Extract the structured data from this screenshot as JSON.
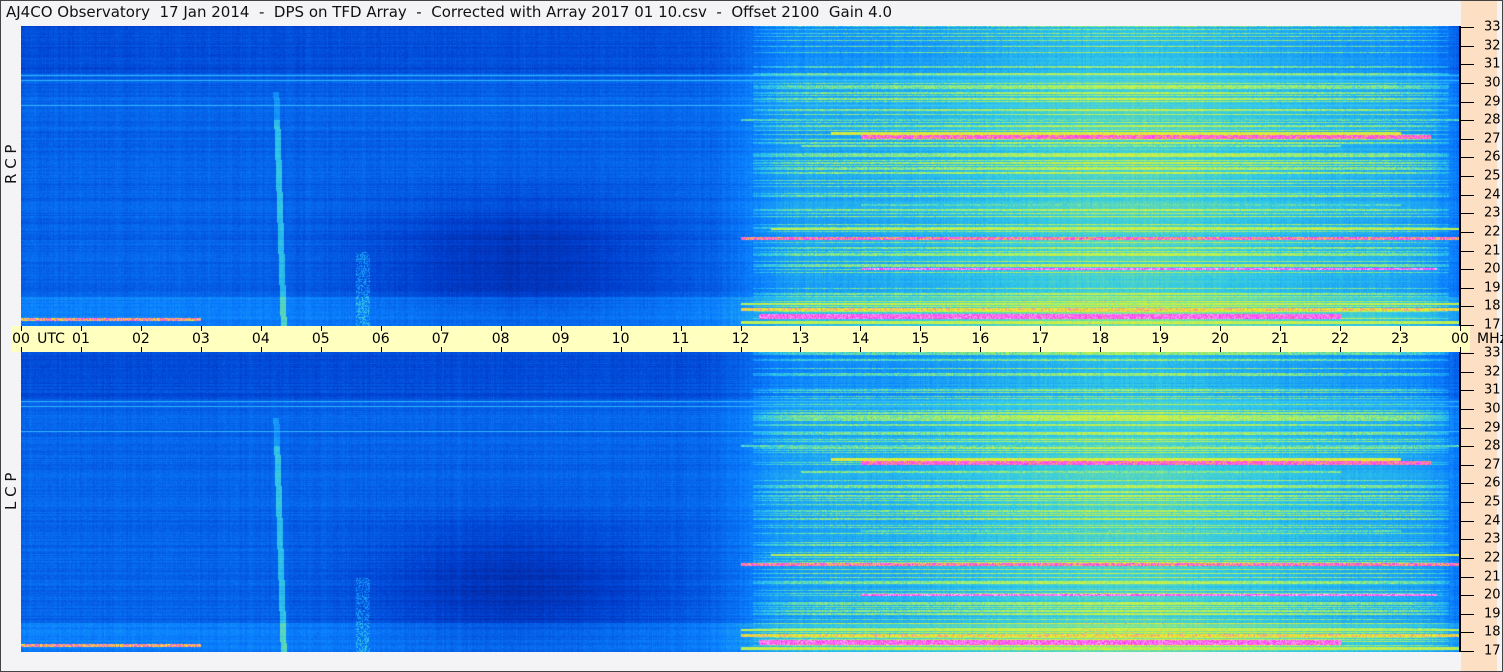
{
  "title": "AJ4CO Observatory  17 Jan 2014  -  DPS on TFD Array  -  Corrected with Array 2017 01 10.csv  -  Offset 2100  Gain 4.0",
  "colors": {
    "strip": "#ffffc0",
    "right_axis_bg": "#fde0c4",
    "background": "#f4f4f6"
  },
  "chart_data": {
    "type": "heatmap",
    "title": "AJ4CO Observatory  17 Jan 2014  -  DPS on TFD Array  -  Corrected with Array 2017 01 10.csv  -  Offset 2100  Gain 4.0",
    "x_axis": {
      "label": "UTC",
      "range_hours": [
        0,
        24
      ],
      "tick_labels": [
        "00",
        "01",
        "02",
        "03",
        "04",
        "05",
        "06",
        "07",
        "08",
        "09",
        "10",
        "11",
        "12",
        "13",
        "14",
        "15",
        "16",
        "17",
        "18",
        "19",
        "20",
        "21",
        "22",
        "23",
        "00"
      ]
    },
    "y_axis": {
      "unit": "MHz",
      "range": [
        17,
        33
      ],
      "tick_labels": [
        "33",
        "32",
        "31",
        "30",
        "29",
        "28",
        "27",
        "26",
        "25",
        "24",
        "23",
        "22",
        "21",
        "20",
        "19",
        "18",
        "17"
      ]
    },
    "panels": [
      {
        "label": "R C P"
      },
      {
        "label": "L C P"
      }
    ],
    "colormap": [
      "#06127a",
      "#0040d0",
      "#0a80ff",
      "#30c8e8",
      "#a0f070",
      "#f0f020",
      "#ff30ff",
      "#ffffff"
    ]
  }
}
